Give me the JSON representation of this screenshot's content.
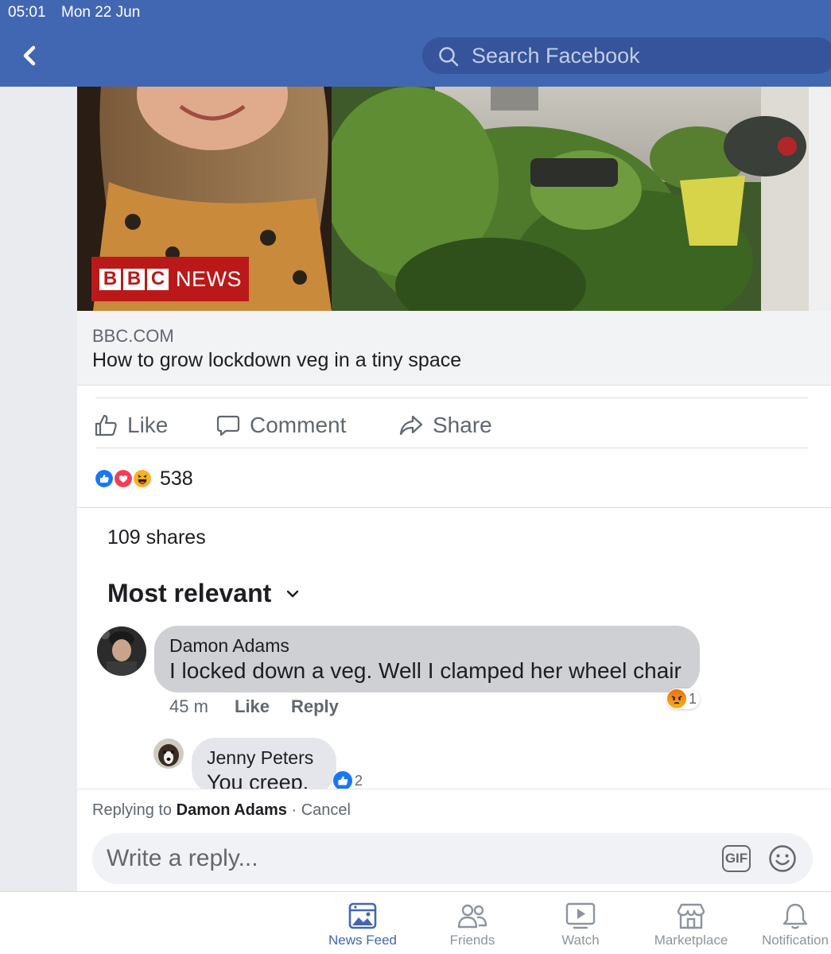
{
  "status_bar": {
    "time": "05:01",
    "date": "Mon 22 Jun"
  },
  "header": {
    "search_placeholder": "Search Facebook"
  },
  "post": {
    "image_badge": {
      "letters": [
        "B",
        "B",
        "C"
      ],
      "word": "NEWS"
    },
    "link": {
      "domain": "BBC.COM",
      "title": "How to grow lockdown veg in a tiny space"
    },
    "actions": {
      "like": "Like",
      "comment": "Comment",
      "share": "Share"
    },
    "reaction_count": "538",
    "shares": "109 shares",
    "sort_label": "Most relevant"
  },
  "comments": [
    {
      "author": "Damon Adams",
      "text": "I locked down a veg. Well I clamped her wheel chair",
      "time": "45 m",
      "like_label": "Like",
      "reply_label": "Reply",
      "reaction_count": "1"
    },
    {
      "author": "Jenny Peters",
      "text": "You creep.",
      "reaction_count": "2"
    }
  ],
  "composer": {
    "replying_prefix": "Replying to",
    "replying_to": "Damon Adams",
    "cancel": "Cancel",
    "placeholder": "Write a reply...",
    "gif_label": "GIF"
  },
  "bottom_nav": [
    {
      "label": "News Feed",
      "active": true
    },
    {
      "label": "Friends"
    },
    {
      "label": "Watch"
    },
    {
      "label": "Marketplace"
    },
    {
      "label": "Notification"
    }
  ],
  "colors": {
    "brand": "#4267b2",
    "bbc_red": "#bb1919",
    "bubble": "#cfd0d4"
  }
}
